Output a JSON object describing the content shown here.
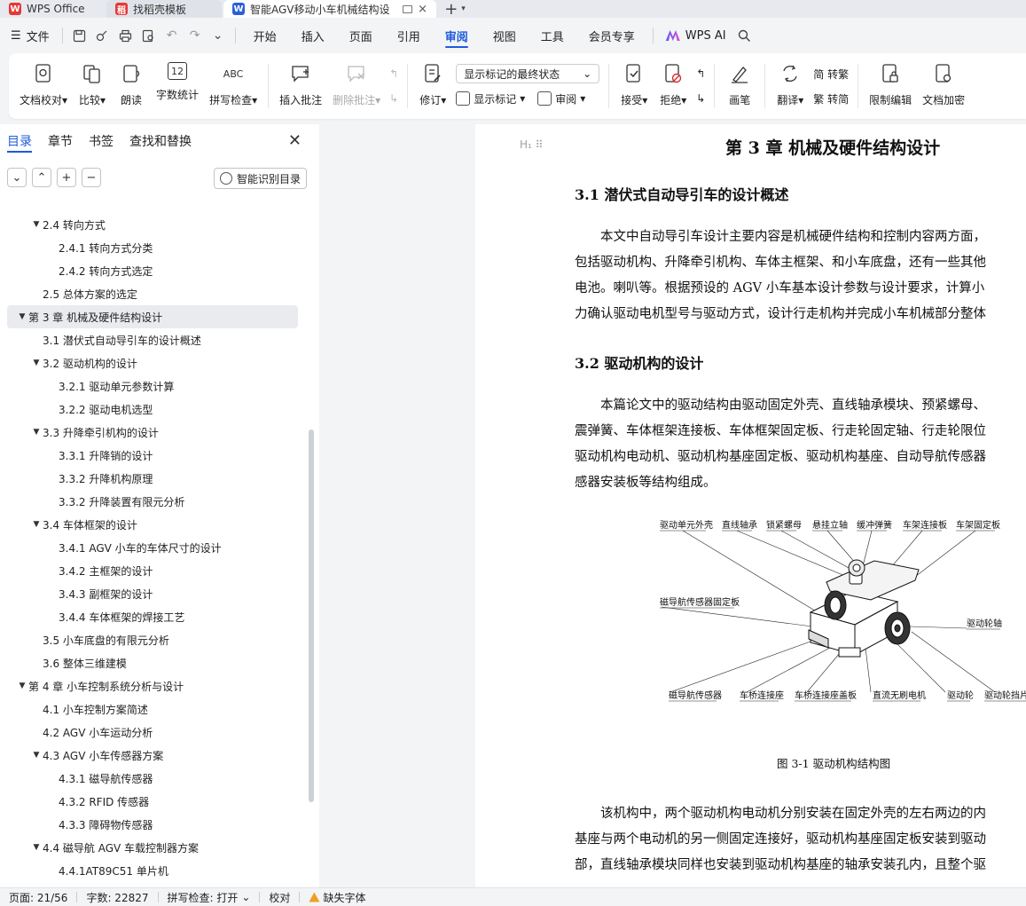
{
  "tabs": [
    {
      "label": "WPS Office",
      "icon": "wps-logo-icon"
    },
    {
      "label": "找稻壳模板",
      "icon": "daoke-logo-icon"
    },
    {
      "label": "智能AGV移动小车机械结构设",
      "icon": "word-doc-icon",
      "close": "×"
    }
  ],
  "menu": {
    "file": "文件",
    "items": [
      "开始",
      "插入",
      "页面",
      "引用",
      "审阅",
      "视图",
      "工具",
      "会员专享"
    ],
    "active": "审阅",
    "wps_ai": "WPS AI"
  },
  "ribbon": {
    "doc_proof": "文档校对",
    "compare": "比较",
    "read_aloud": "朗读",
    "word_count": "字数统计",
    "spell_check": "拼写检查",
    "insert_comment": "插入批注",
    "delete_comment": "删除批注",
    "revise": "修订",
    "markup_dropdown": "显示标记的最终状态",
    "show_markup": "显示标记",
    "review": "审阅",
    "accept": "接受",
    "reject": "拒绝",
    "pen": "画笔",
    "translate": "翻译",
    "to_traditional": "简 转繁",
    "to_simplified": "繁 转简",
    "restrict_edit": "限制编辑",
    "encrypt": "文档加密",
    "word_count_icon_text": "12",
    "spell_icon_text": "ABC"
  },
  "nav": {
    "tabs": [
      "目录",
      "章节",
      "书签",
      "查找和替换"
    ],
    "active_tab": "目录",
    "smart_toc": "智能识别目录",
    "toc": [
      {
        "label": "2.4  转向方式",
        "level": 2,
        "arrow": "▼"
      },
      {
        "label": "2.4.1  转向方式分类",
        "level": 3
      },
      {
        "label": "2.4.2  转向方式选定",
        "level": 3
      },
      {
        "label": "2.5  总体方案的选定",
        "level": 2
      },
      {
        "label": "第 3 章  机械及硬件结构设计",
        "level": 1,
        "arrow": "▼",
        "selected": true
      },
      {
        "label": "3.1  潜伏式自动导引车的设计概述",
        "level": 2
      },
      {
        "label": "3.2  驱动机构的设计",
        "level": 2,
        "arrow": "▼"
      },
      {
        "label": "3.2.1  驱动单元参数计算",
        "level": 3
      },
      {
        "label": "3.2.2  驱动电机选型",
        "level": 3
      },
      {
        "label": "3.3  升降牵引机构的设计",
        "level": 2,
        "arrow": "▼"
      },
      {
        "label": "3.3.1 升降销的设计",
        "level": 3
      },
      {
        "label": "3.3.2  升降机构原理",
        "level": 3
      },
      {
        "label": "3.3.2  升降装置有限元分析",
        "level": 3
      },
      {
        "label": "3.4  车体框架的设计",
        "level": 2,
        "arrow": "▼"
      },
      {
        "label": "3.4.1 AGV 小车的车体尺寸的设计",
        "level": 3
      },
      {
        "label": "3.4.2  主框架的设计",
        "level": 3
      },
      {
        "label": "3.4.3  副框架的设计",
        "level": 3
      },
      {
        "label": "3.4.4  车体框架的焊接工艺",
        "level": 3
      },
      {
        "label": "3.5 小车底盘的有限元分析",
        "level": 2
      },
      {
        "label": "3.6  整体三维建模",
        "level": 2
      },
      {
        "label": "第 4 章  小车控制系统分析与设计",
        "level": 1,
        "arrow": "▼"
      },
      {
        "label": "4.1  小车控制方案简述",
        "level": 2
      },
      {
        "label": "4.2 AGV 小车运动分析",
        "level": 2
      },
      {
        "label": "4.3 AGV 小车传感器方案",
        "level": 2,
        "arrow": "▼"
      },
      {
        "label": "4.3.1 磁导航传感器",
        "level": 3
      },
      {
        "label": "4.3.2 RFID 传感器",
        "level": 3
      },
      {
        "label": "4.3.3  障碍物传感器",
        "level": 3
      },
      {
        "label": "4.4  磁导航 AGV 车载控制器方案",
        "level": 2,
        "arrow": "▼"
      },
      {
        "label": "4.4.1AT89C51 单片机",
        "level": 3
      }
    ]
  },
  "doc": {
    "heading_marker": "H",
    "chapter_title": "第 3 章  机械及硬件结构设计",
    "s31_title": "3.1  潜伏式自动导引车的设计概述",
    "s31_lines": [
      "本文中自动导引车设计主要内容是机械硬件结构和控制内容两方面，",
      "包括驱动机构、升降牵引机构、车体主框架、和小车底盘，还有一些其他",
      "电池。喇叭等。根据预设的 AGV 小车基本设计参数与设计要求，计算小",
      "力确认驱动电机型号与驱动方式，设计行走机构并完成小车机械部分整体"
    ],
    "s32_title": "3.2  驱动机构的设计",
    "s32_lines": [
      "本篇论文中的驱动结构由驱动固定外壳、直线轴承模块、预紧螺母、",
      "震弹簧、车体框架连接板、车体框架固定板、行走轮固定轴、行走轮限位",
      "驱动机构电动机、驱动机构基座固定板、驱动机构基座、自动导航传感器",
      "感器安装板等结构组成。"
    ],
    "figure_labels_top": [
      "驱动单元外壳",
      "直线轴承",
      "锁紧螺母",
      "悬挂立轴",
      "缓冲弹簧",
      "车架连接板",
      "车架固定板"
    ],
    "figure_label_left": "磁导航传感器固定板",
    "figure_label_right": "驱动轮轴",
    "figure_labels_bottom": [
      "磁导航传感器",
      "车桥连接座",
      "车桥连接座盖板",
      "直流无刷电机",
      "驱动轮",
      "驱动轮挡片"
    ],
    "figure_caption": "图 3-1    驱动机构结构图",
    "after_lines": [
      "该机构中，两个驱动机构电动机分别安装在固定外壳的左右两边的内",
      "基座与两个电动机的另一侧固定连接好，驱动机构基座固定板安装到驱动",
      "部，直线轴承模块同样也安装到驱动机构基座的轴承安装孔内，且整个驱"
    ]
  },
  "status": {
    "page": "页面: 21/56",
    "words": "字数: 22827",
    "spell": "拼写检查: 打开",
    "proof": "校对",
    "missing_font": "缺失字体"
  }
}
